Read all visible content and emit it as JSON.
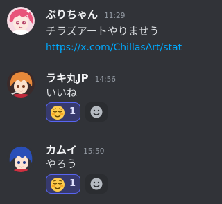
{
  "messages": [
    {
      "username": "ぶりちゃん",
      "timestamp": "11:29",
      "text": "チラズアートやりませう",
      "link": "https://x.com/ChillasArt/stat"
    },
    {
      "username": "ラキ丸JP",
      "timestamp": "14:56",
      "text": "いいね",
      "reaction": {
        "emoji": "relieved-face",
        "count": "1"
      }
    },
    {
      "username": "カムイ",
      "timestamp": "15:50",
      "text": "やろう",
      "reaction": {
        "emoji": "relieved-face",
        "count": "1"
      }
    }
  ],
  "colors": {
    "background": "#313338",
    "link": "#00a8fc",
    "reaction_border": "#5865f2",
    "reaction_bg": "#373a6d"
  },
  "icons": {
    "add_reaction": "smiley-add-icon"
  }
}
